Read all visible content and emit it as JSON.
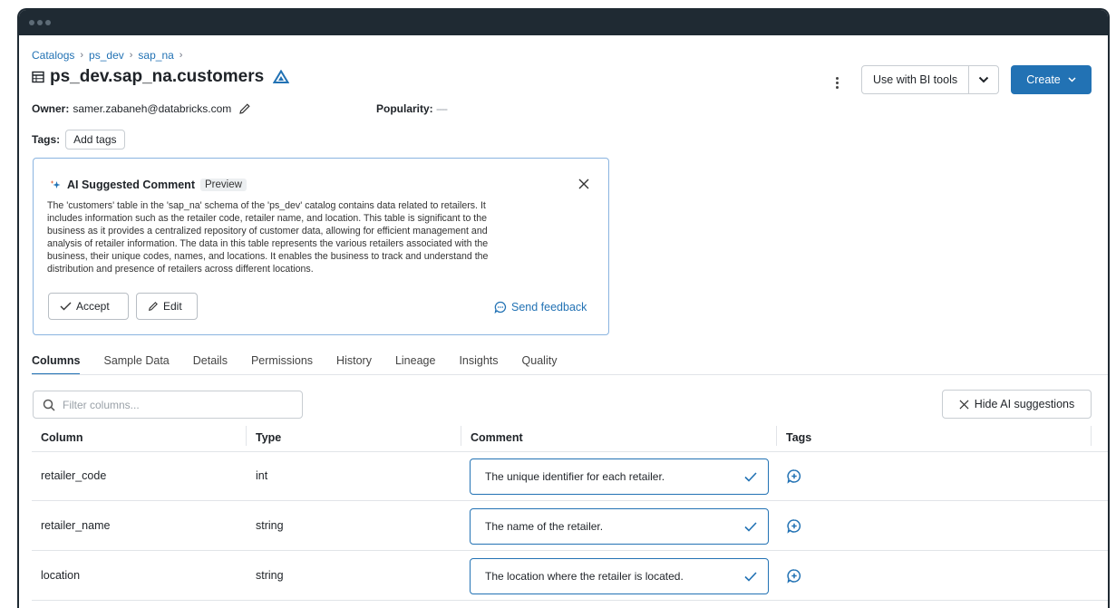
{
  "breadcrumbs": [
    "Catalogs",
    "ps_dev",
    "sap_na"
  ],
  "table_name": "ps_dev.sap_na.customers",
  "header": {
    "bi_tools_label": "Use with BI tools",
    "create_label": "Create"
  },
  "owner": {
    "label": "Owner:",
    "value": "samer.zabaneh@databricks.com"
  },
  "popularity": {
    "label": "Popularity:",
    "value": "----"
  },
  "tags": {
    "label": "Tags:",
    "add_label": "Add tags"
  },
  "ai_card": {
    "title": "AI Suggested Comment",
    "badge": "Preview",
    "lines": [
      "The 'customers' table in the 'sap_na' schema of the 'ps_dev' catalog contains data related to retailers. It",
      "includes information such as the retailer code, retailer name, and location. This table is significant to the",
      "business as it provides a centralized repository of customer data, allowing for efficient management and",
      "analysis of retailer information. The data in this table represents the various retailers associated with the",
      "business, their unique codes, names, and locations. It enables the business to track and understand the",
      "distribution and presence of retailers across different locations."
    ],
    "accept_label": "Accept",
    "edit_label": "Edit",
    "feedback_label": "Send feedback"
  },
  "tabs": [
    "Columns",
    "Sample Data",
    "Details",
    "Permissions",
    "History",
    "Lineage",
    "Insights",
    "Quality"
  ],
  "active_tab": "Columns",
  "filter": {
    "placeholder": "Filter columns..."
  },
  "hide_ai_label": "Hide AI suggestions",
  "table": {
    "headers": [
      "Column",
      "Type",
      "Comment",
      "Tags"
    ],
    "rows": [
      {
        "column": "retailer_code",
        "type": "int",
        "comment": "The unique identifier for each retailer."
      },
      {
        "column": "retailer_name",
        "type": "string",
        "comment": "The name of the retailer."
      },
      {
        "column": "location",
        "type": "string",
        "comment": "The location where the retailer is located."
      }
    ]
  },
  "colors": {
    "accent": "#2272b4",
    "titlebar": "#1f2a33",
    "ai_border": "#8ab4e0"
  }
}
